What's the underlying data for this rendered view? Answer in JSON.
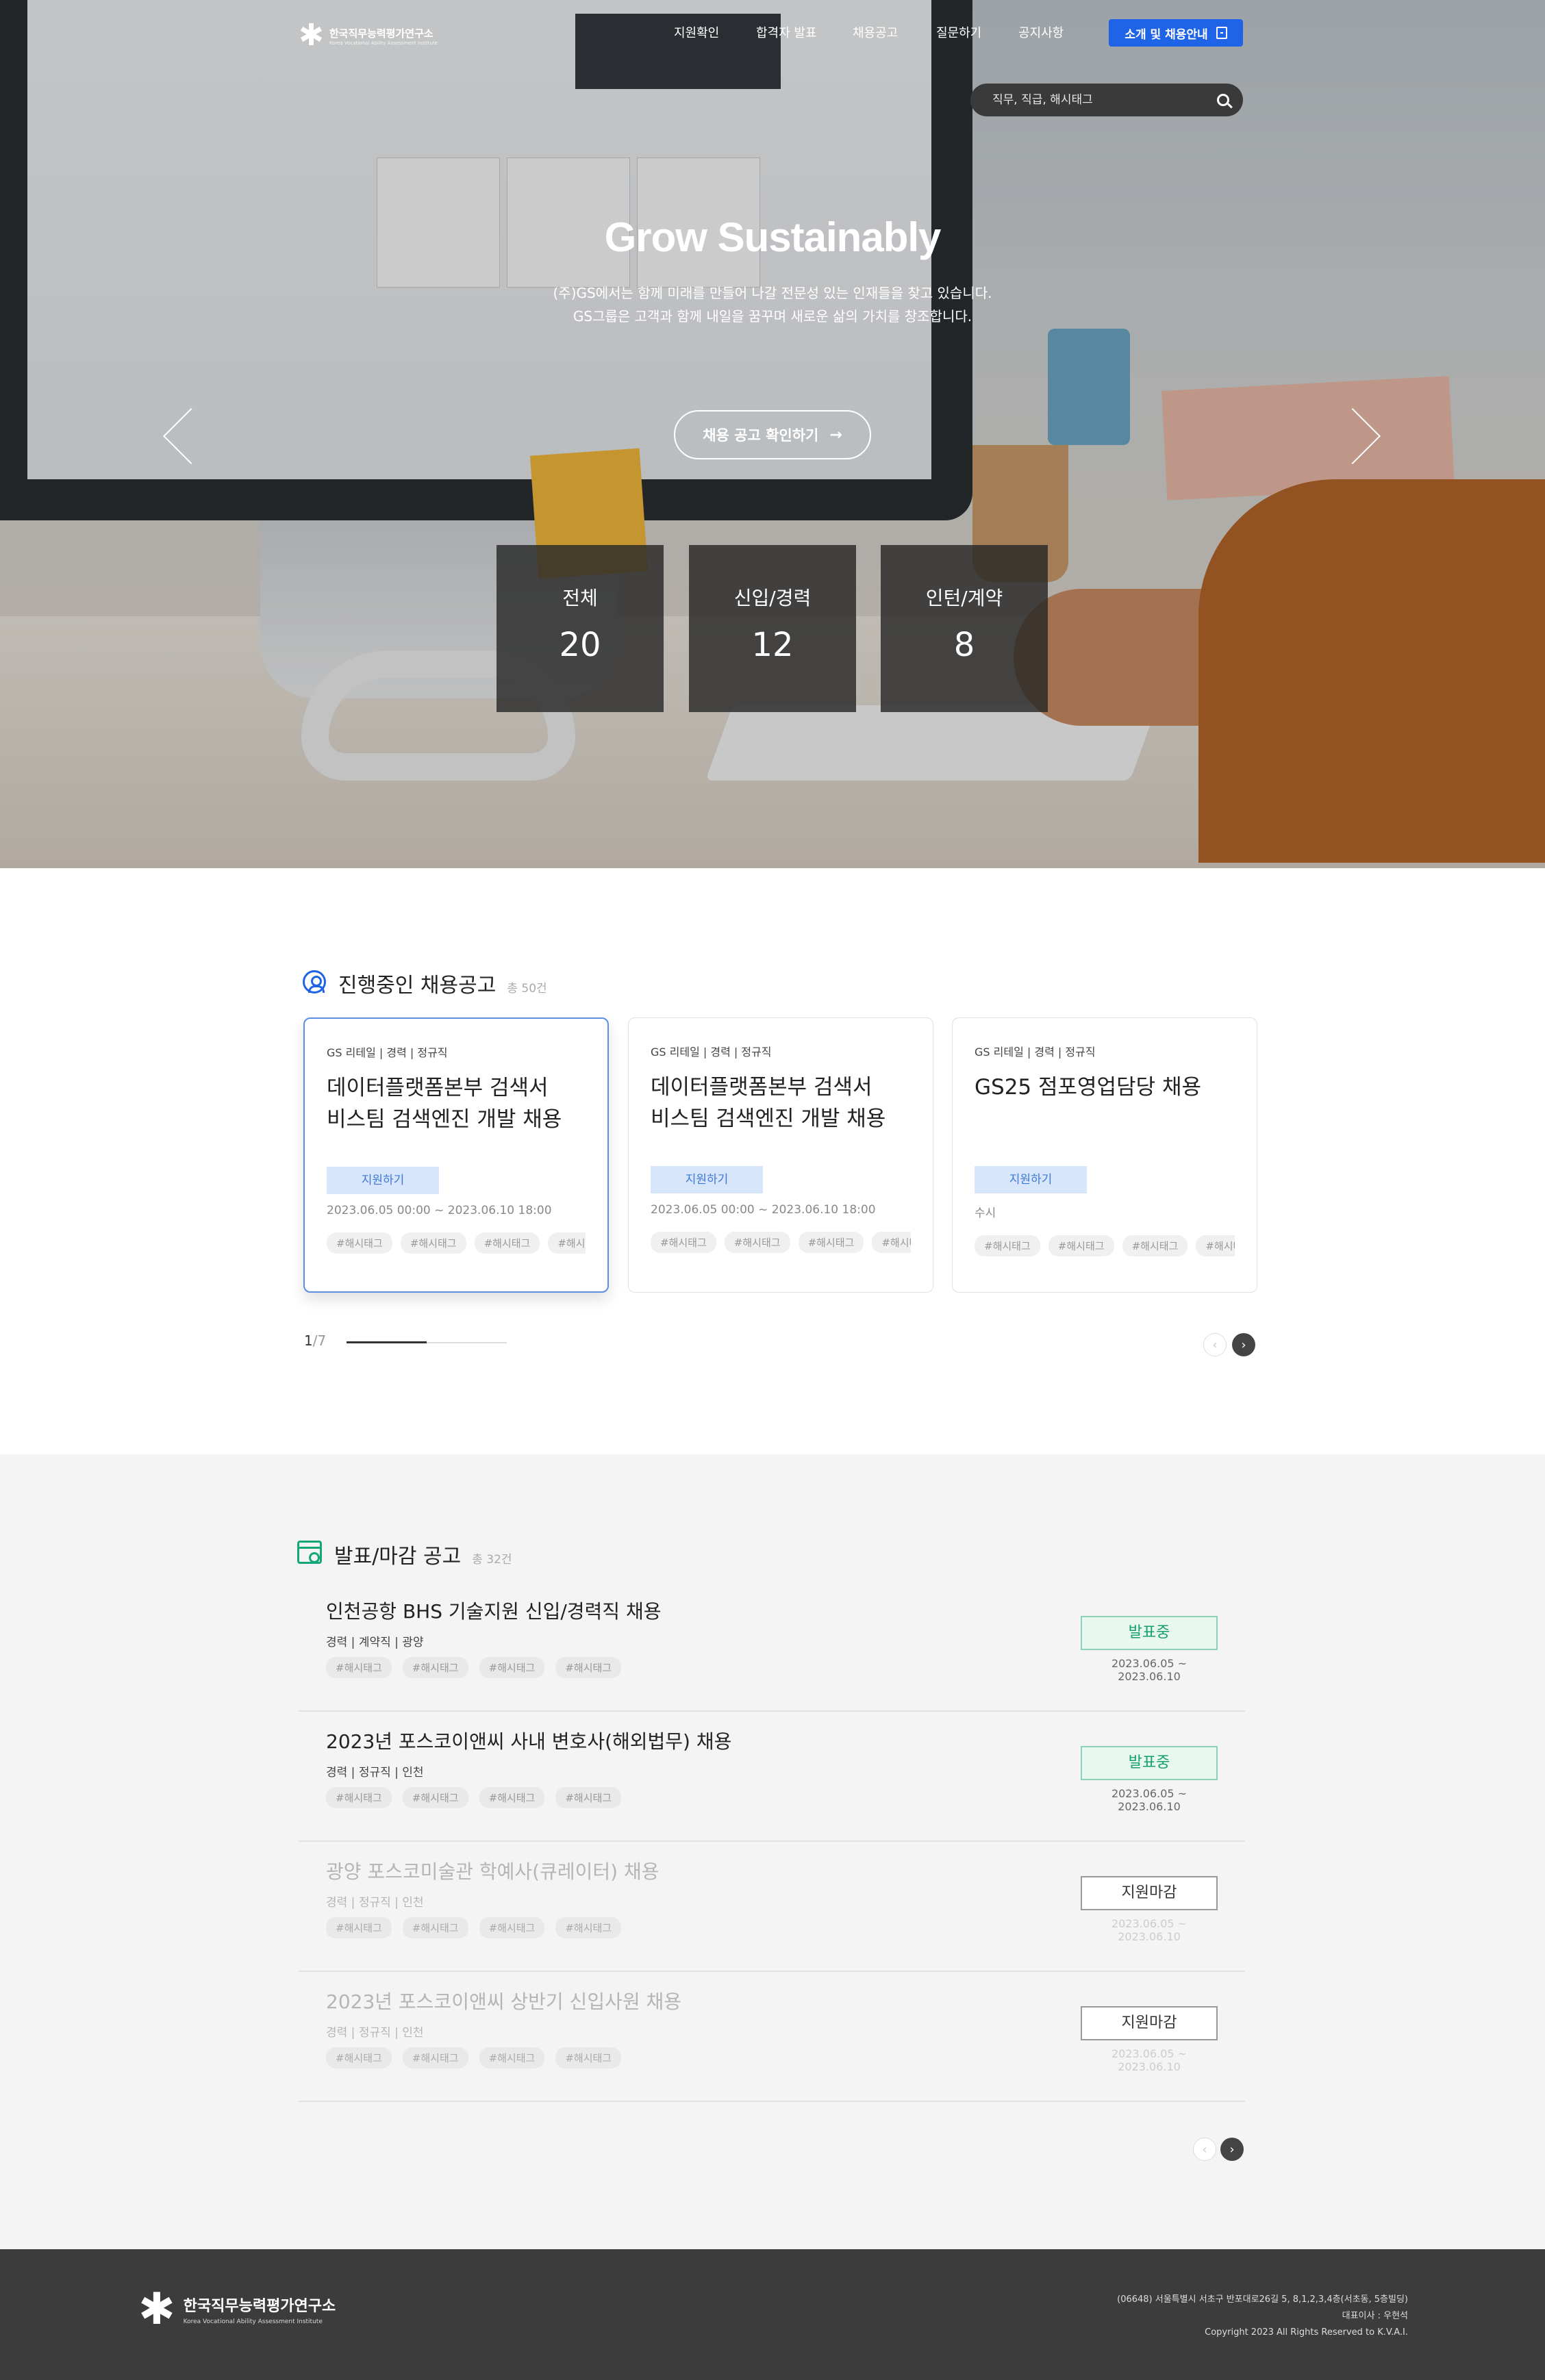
{
  "header": {
    "logo_ko": "한국직무능력평가연구소",
    "logo_en": "Korea Vocational Ability Assessment Institute",
    "nav": [
      "지원확인",
      "합격자 발표",
      "채용공고",
      "질문하기",
      "공지사항"
    ],
    "cta_label": "소개 및 채용안내",
    "search_placeholder": "직무, 직급, 해시태그"
  },
  "hero": {
    "title": "Grow Sustainably",
    "subtitle_1": "(주)GS에서는 함께 미래를 만들어 나갈 전문성 있는 인재들을 찾고 있습니다.",
    "subtitle_2": "GS그룹은 고객과 함께 내일을 꿈꾸며 새로운 삶의 가치를 창조합니다.",
    "button_label": "채용 공고 확인하기",
    "stats": [
      {
        "label": "전체",
        "value": "20"
      },
      {
        "label": "신입/경력",
        "value": "12"
      },
      {
        "label": "인턴/계약",
        "value": "8"
      }
    ]
  },
  "ongoing": {
    "title": "진행중인 채용공고",
    "count": "총 50건",
    "cards": [
      {
        "meta": "GS 리테일  |  경력  |  정규직",
        "title_1": "데이터플랫폼본부 검색서",
        "title_2": "비스팀 검색엔진 개발 채용",
        "apply": "지원하기",
        "date": "2023.06.05 00:00 ~ 2023.06.10 18:00",
        "tags": [
          "#해시태그",
          "#해시태그",
          "#해시태그",
          "#해시태그"
        ]
      },
      {
        "meta": "GS 리테일  |  경력  |  정규직",
        "title_1": "데이터플랫폼본부 검색서",
        "title_2": "비스팀 검색엔진 개발 채용",
        "apply": "지원하기",
        "date": "2023.06.05 00:00 ~ 2023.06.10 18:00",
        "tags": [
          "#해시태그",
          "#해시태그",
          "#해시태그",
          "#해시태그"
        ]
      },
      {
        "meta": "GS 리테일  |  경력  |  정규직",
        "title_1": "GS25 점포영업담당 채용",
        "title_2": "",
        "apply": "지원하기",
        "date": "수시",
        "tags": [
          "#해시태그",
          "#해시태그",
          "#해시태그",
          "#해시태그"
        ]
      }
    ],
    "pager_current": "1",
    "pager_total": "/7",
    "pager_progress": 0.5
  },
  "closing": {
    "title": "발표/마감 공고",
    "count": "총 32건",
    "rows": [
      {
        "title": "인천공항 BHS 기술지원 신입/경력직 채용",
        "meta": "경력  |  계약직  |  광양",
        "tags": [
          "#해시태그",
          "#해시태그",
          "#해시태그",
          "#해시태그"
        ],
        "status": "발표중",
        "date": "2023.06.05 ~ 2023.06.10"
      },
      {
        "title": "2023년 포스코이앤씨 사내 변호사(해외법무) 채용",
        "meta": "경력  |  정규직  |  인천",
        "tags": [
          "#해시태그",
          "#해시태그",
          "#해시태그",
          "#해시태그"
        ],
        "status": "발표중",
        "date": "2023.06.05 ~ 2023.06.10"
      },
      {
        "title": "광양 포스코미술관 학예사(큐레이터) 채용",
        "meta": "경력  |  정규직  |  인천",
        "tags": [
          "#해시태그",
          "#해시태그",
          "#해시태그",
          "#해시태그"
        ],
        "status": "지원마감",
        "date": "2023.06.05 ~ 2023.06.10"
      },
      {
        "title": "2023년 포스코이앤씨 상반기 신입사원 채용",
        "meta": "경력  |  정규직  |  인천",
        "tags": [
          "#해시태그",
          "#해시태그",
          "#해시태그",
          "#해시태그"
        ],
        "status": "지원마감",
        "date": "2023.06.05 ~ 2023.06.10"
      }
    ]
  },
  "footer": {
    "logo_ko": "한국직무능력평가연구소",
    "logo_en": "Korea Vocational Ability Assessment Institute",
    "address": "(06648) 서울특별시 서초구 반포대로26길 5, 8,1,2,3,4층(서초동, 5층빌딩)",
    "ceo": "대표이사 : 우현석",
    "copyright": "Copyright 2023 All Rights Reserved to K.V.A.I."
  },
  "colors": {
    "accent_blue": "#1f63e6",
    "accent_green": "#14a06f",
    "footer_bg": "#3c3c3c"
  },
  "icons": [
    "asterisk-logo-icon",
    "document-icon",
    "search-icon",
    "arrow-right-icon",
    "chevron-left-icon",
    "chevron-right-icon",
    "user-search-icon",
    "calendar-icon"
  ]
}
